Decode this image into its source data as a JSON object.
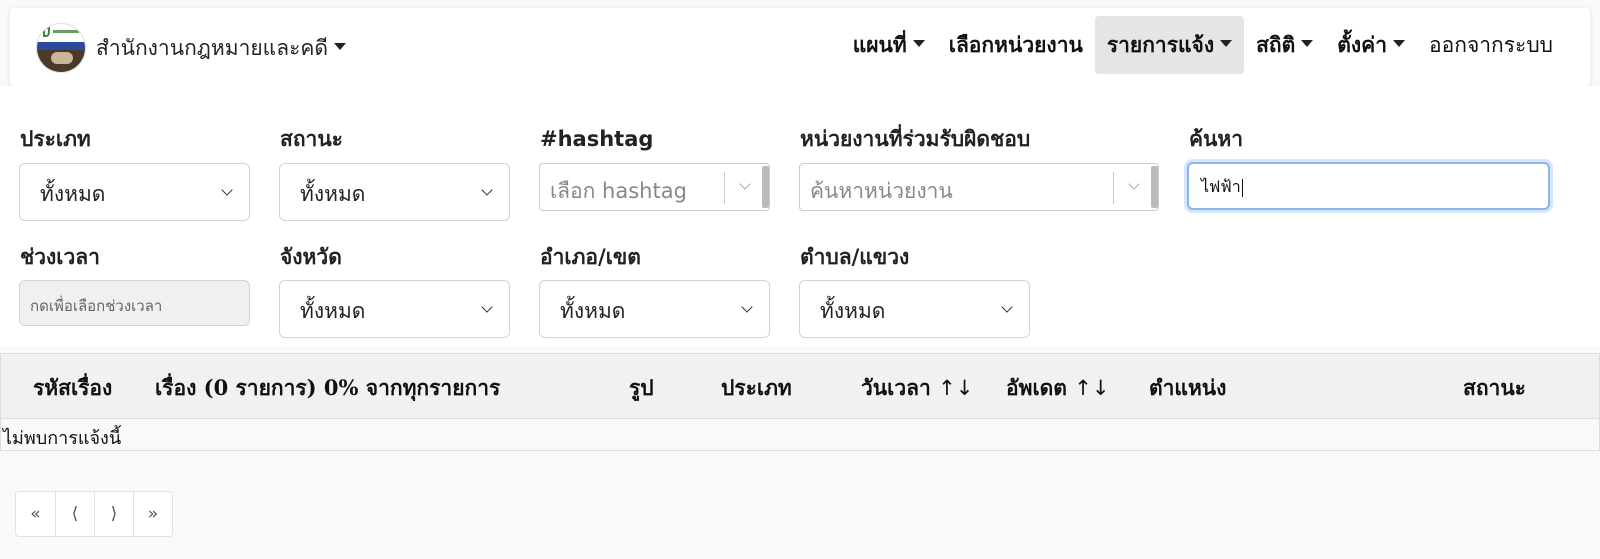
{
  "navbar": {
    "brand_label": "สำนักงานกฎหมายและคดี",
    "items": [
      {
        "label": "แผนที่",
        "dropdown": true
      },
      {
        "label": "เลือกหน่วยงาน",
        "dropdown": false
      },
      {
        "label": "รายการแจ้ง",
        "dropdown": true,
        "active": true
      },
      {
        "label": "สถิติ",
        "dropdown": true
      },
      {
        "label": "ตั้งค่า",
        "dropdown": true
      },
      {
        "label": "ออกจากระบบ",
        "dropdown": false
      }
    ]
  },
  "filters": {
    "type": {
      "label": "ประเภท",
      "value": "ทั้งหมด"
    },
    "status": {
      "label": "สถานะ",
      "value": "ทั้งหมด"
    },
    "hashtag": {
      "label": "#hashtag",
      "placeholder": "เลือก hashtag"
    },
    "agency": {
      "label": "หน่วยงานที่ร่วมรับผิดชอบ",
      "placeholder": "ค้นหาหน่วยงาน"
    },
    "search": {
      "label": "ค้นหา",
      "value": "ไฟฟ้า"
    },
    "period": {
      "label": "ช่วงเวลา",
      "placeholder": "กดเพื่อเลือกช่วงเวลา"
    },
    "province": {
      "label": "จังหวัด",
      "value": "ทั้งหมด"
    },
    "district": {
      "label": "อำเภอ/เขต",
      "value": "ทั้งหมด"
    },
    "subdistrict": {
      "label": "ตำบล/แขวง",
      "value": "ทั้งหมด"
    }
  },
  "table": {
    "columns": {
      "id": "รหัสเรื่อง",
      "subject": "เรื่อง (0 รายการ) 0% จากทุกรายการ",
      "image": "รูป",
      "type": "ประเภท",
      "datetime": "วันเวลา",
      "updated": "อัพเดต",
      "location": "ตำแหน่ง",
      "status": "สถานะ"
    },
    "sort_icon": "↑↓",
    "empty_message": "ไม่พบการแจ้งนี้"
  },
  "pagination": {
    "first": "«",
    "prev": "⟨",
    "next": "⟩",
    "last": "»"
  }
}
